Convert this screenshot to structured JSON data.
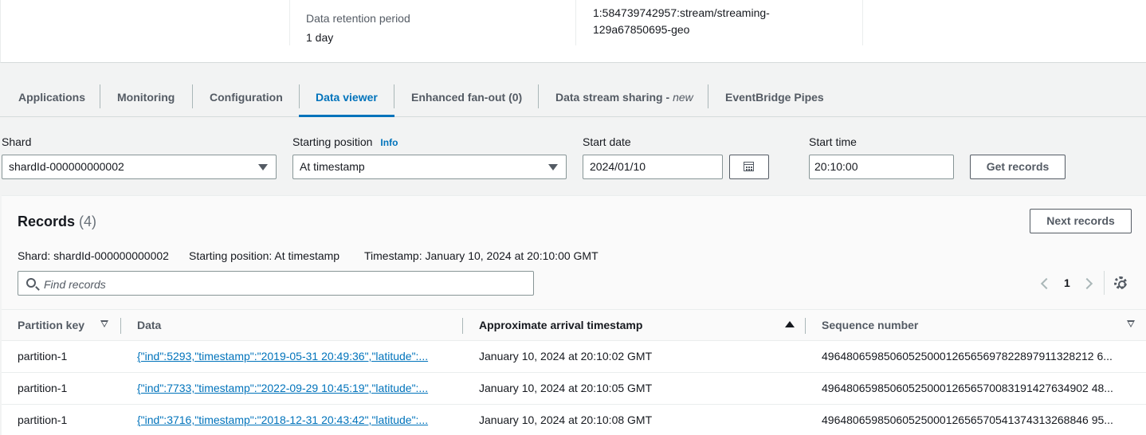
{
  "details": {
    "retention_label": "Data retention period",
    "retention_value": "1 day",
    "arn_line1": "1:584739742957:stream/streaming-",
    "arn_line2": "129a67850695-geo"
  },
  "tabs": [
    {
      "label": "Applications"
    },
    {
      "label": "Monitoring"
    },
    {
      "label": "Configuration"
    },
    {
      "label": "Data viewer"
    },
    {
      "label": "Enhanced fan-out (0)"
    },
    {
      "label": "Data stream sharing - ",
      "suffix": "new"
    },
    {
      "label": "EventBridge Pipes"
    }
  ],
  "filters": {
    "shard_label": "Shard",
    "shard_value": "shardId-000000000002",
    "position_label": "Starting position",
    "position_info": "Info",
    "position_value": "At timestamp",
    "date_label": "Start date",
    "date_value": "2024/01/10",
    "time_label": "Start time",
    "time_value": "20:10:00",
    "get_records": "Get records"
  },
  "records": {
    "title": "Records",
    "count": "(4)",
    "next_button": "Next records",
    "meta_shard": "Shard: shardId-000000000002",
    "meta_position": "Starting position: At timestamp",
    "meta_timestamp": "Timestamp: January 10, 2024 at 20:10:00 GMT",
    "search_placeholder": "Find records",
    "page": "1",
    "columns": [
      "Partition key",
      "Data",
      "Approximate arrival timestamp",
      "Sequence number"
    ],
    "rows": [
      {
        "key": "partition-1",
        "data": "{\"ind\":5293,\"timestamp\":\"2019-05-31 20:49:36\",\"latitude\":...",
        "arrival": "January 10, 2024 at 20:10:02 GMT",
        "seq": "49648065985060525000126565697822897911328212 6..."
      },
      {
        "key": "partition-1",
        "data": "{\"ind\":7733,\"timestamp\":\"2022-09-29 10:45:19\",\"latitude\":...",
        "arrival": "January 10, 2024 at 20:10:05 GMT",
        "seq": "4964806598506052500012656570083191427634902 48..."
      },
      {
        "key": "partition-1",
        "data": "{\"ind\":3716,\"timestamp\":\"2018-12-31 20:43:42\",\"latitude\":...",
        "arrival": "January 10, 2024 at 20:10:08 GMT",
        "seq": "4964806598506052500012656570541374313268846 95..."
      }
    ]
  }
}
